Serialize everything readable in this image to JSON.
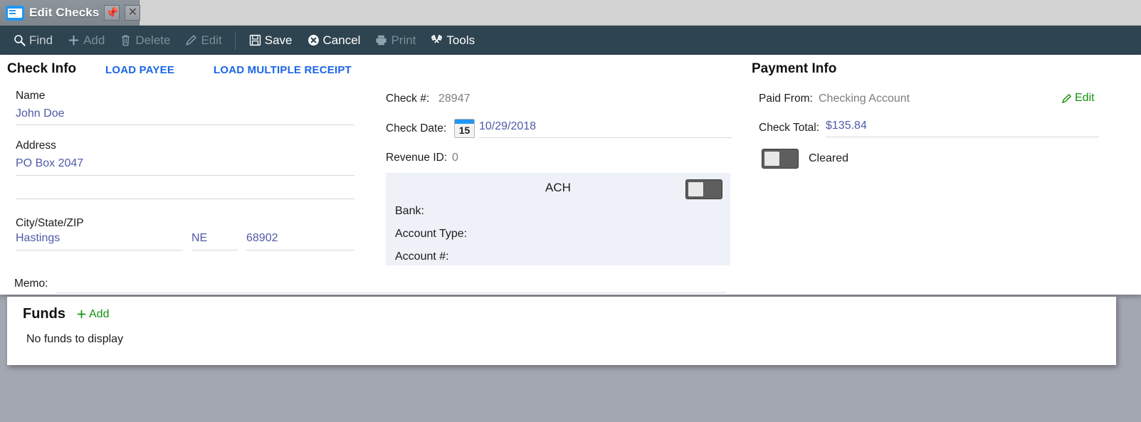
{
  "window": {
    "title": "Edit Checks",
    "app_icon": "check-document-icon",
    "pin_icon": "pin-icon",
    "close_icon": "close-icon"
  },
  "toolbar": {
    "items": [
      {
        "label": "Find",
        "icon": "search-icon",
        "enabled": true
      },
      {
        "label": "Add",
        "icon": "plus-icon",
        "enabled": false
      },
      {
        "label": "Delete",
        "icon": "trash-icon",
        "enabled": false
      },
      {
        "label": "Edit",
        "icon": "pencil-icon",
        "enabled": false
      },
      {
        "label": "Save",
        "icon": "floppy-icon",
        "enabled": true
      },
      {
        "label": "Cancel",
        "icon": "x-circle-icon",
        "enabled": true
      },
      {
        "label": "Print",
        "icon": "printer-icon",
        "enabled": false
      },
      {
        "label": "Tools",
        "icon": "wrench-icon",
        "enabled": true
      }
    ]
  },
  "check_info": {
    "heading": "Check Info",
    "load_payee_label": "LOAD PAYEE",
    "load_multiple_receipt_label": "LOAD MULTIPLE RECEIPT",
    "name_label": "Name",
    "name_value": "John Doe",
    "address_label": "Address",
    "address_line1": "PO Box 2047",
    "address_line2": "",
    "citystatezip_label": "City/State/ZIP",
    "city_value": "Hastings",
    "state_value": "NE",
    "zip_value": "68902",
    "memo_label": "Memo:",
    "memo_value": ""
  },
  "check_details": {
    "check_number_label": "Check #:",
    "check_number_value": "28947",
    "check_date_label": "Check Date:",
    "check_date_value": "10/29/2018",
    "calendar_icon_day": "15",
    "revenue_id_label": "Revenue ID:",
    "revenue_id_value": "0"
  },
  "ach": {
    "title": "ACH",
    "toggle_state": "off",
    "bank_label": "Bank:",
    "bank_value": "",
    "account_type_label": "Account Type:",
    "account_type_value": "",
    "account_number_label": "Account #:",
    "account_number_value": ""
  },
  "payment_info": {
    "heading": "Payment Info",
    "paid_from_label": "Paid From:",
    "paid_from_value": "Checking Account",
    "edit_label": "Edit",
    "check_total_label": "Check Total:",
    "check_total_value": "$135.84",
    "cleared_label": "Cleared",
    "cleared_state": "off"
  },
  "funds": {
    "title": "Funds",
    "add_label": "Add",
    "empty_message": "No funds to display"
  },
  "colors": {
    "toolbar_bg": "#2e4450",
    "link_blue": "#1a66e8",
    "value_violet": "#4f5aa8",
    "green": "#13930f",
    "ach_bg": "#eef1f8",
    "page_bg": "#a3a7b1"
  }
}
